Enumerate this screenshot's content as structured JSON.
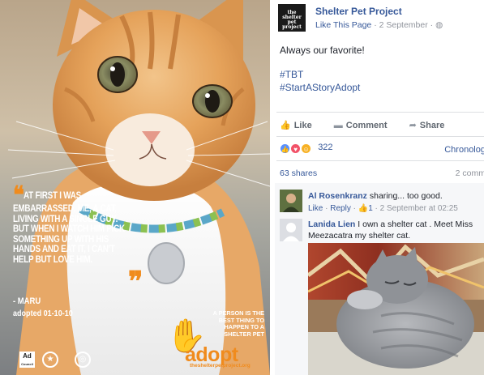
{
  "poster": {
    "quote_open": "❝",
    "quote_text": "At first I was embarrassed. Me, a cat, living with a single guy. But when I watch him pick something up with his hands and eat it, I can't help but love him.",
    "quote_close": "❞",
    "attribution": "- MARU",
    "adopted_date": "adopted 01-10-10",
    "tagline": "A person is the best thing to happen to a shelter pet",
    "adopt_word": "adopt",
    "adopt_url": "theshelterpetproject.org",
    "ad_council_logo": "Ad Council",
    "hand_icon": "paw-hand-icon"
  },
  "post": {
    "page_avatar_text": "the shelter pet project",
    "page_name": "Shelter Pet Project",
    "like_page": "Like This Page",
    "date": "2 September",
    "separator": "·",
    "globe_icon": "globe-icon",
    "text": "Always our favorite!",
    "hashtags": [
      "#TBT",
      "#StartAStoryAdopt"
    ],
    "actions": {
      "like": "Like",
      "comment": "Comment",
      "share": "Share"
    },
    "reactions_count": "322",
    "chronological": "Chronolog",
    "shares": "63 shares",
    "comments_count": "2 comm"
  },
  "comments": [
    {
      "author": "Al Rosenkranz",
      "text": "sharing... too good.",
      "like": "Like",
      "reply": "Reply",
      "likes": "1",
      "time": "2 September at 02:25"
    },
    {
      "author": "Lanida Lien",
      "text_line1": "I own a shelter cat . Meet Miss",
      "text_line2": "Meezacatra my shelter cat."
    }
  ],
  "colors": {
    "facebook_blue": "#365899",
    "text": "#1d2129",
    "muted": "#90949c",
    "adopt_orange": "#f08b1d",
    "love_red": "#f25268",
    "like_blue": "#5890ff",
    "haha_yellow": "#f7b125"
  }
}
